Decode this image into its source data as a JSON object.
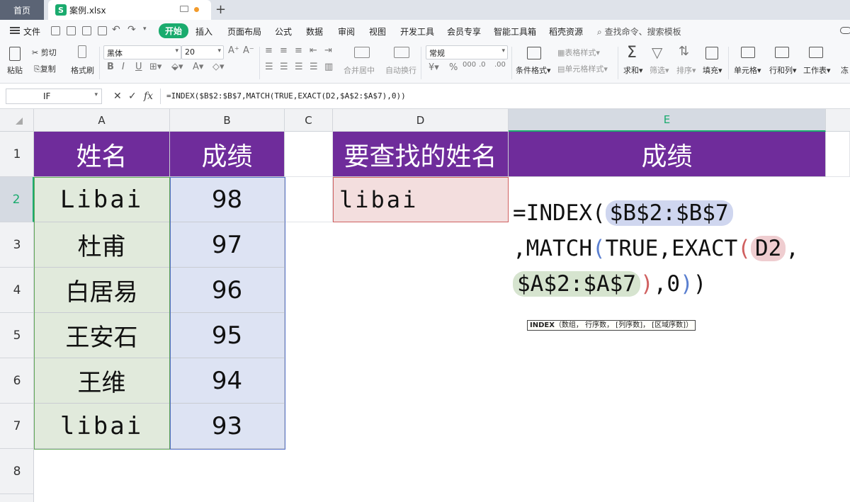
{
  "titlebar": {
    "home_tab": "首页",
    "file_tab": "案例.xlsx",
    "file_icon": "S"
  },
  "menu": {
    "file": "文件",
    "items": [
      "开始",
      "插入",
      "页面布局",
      "公式",
      "数据",
      "审阅",
      "视图",
      "开发工具",
      "会员专享",
      "智能工具箱",
      "稻壳资源"
    ],
    "active_index": 0,
    "search": "查找命令、搜索模板"
  },
  "ribbon": {
    "paste": "粘贴",
    "cut": "剪切",
    "copy": "复制",
    "format_painter": "格式刷",
    "font_name": "黑体",
    "font_size": "20",
    "number_format": "常规",
    "merge_center": "合并居中",
    "wrap_text": "自动换行",
    "conditional_format": "条件格式",
    "table_style": "表格样式",
    "cell_style": "单元格样式",
    "sum": "求和",
    "filter": "筛选",
    "sort": "排序",
    "fill": "填充",
    "cell": "单元格",
    "row_col": "行和列",
    "worksheet": "工作表",
    "freeze": "冻"
  },
  "formula_bar": {
    "name_box": "IF",
    "formula": "=INDEX($B$2:$B$7,MATCH(TRUE,EXACT(D2,$A$2:$A$7),0))"
  },
  "columns": [
    "A",
    "B",
    "C",
    "D",
    "E"
  ],
  "rows": [
    "1",
    "2",
    "3",
    "4",
    "5",
    "6",
    "7",
    "8"
  ],
  "sheet": {
    "A1": "姓名",
    "B1": "成绩",
    "D1": "要查找的姓名",
    "E1": "成绩",
    "D2": "libai",
    "names": [
      "Libai",
      "杜甫",
      "白居易",
      "王安石",
      "王维",
      "libai"
    ],
    "scores": [
      "98",
      "97",
      "96",
      "95",
      "94",
      "93"
    ]
  },
  "cell_formula": {
    "eq_index": "=INDEX(",
    "ref_b": "$B$2:$B$7",
    "match": ",MATCH",
    "open1": "(",
    "true_exact": "TRUE,EXACT",
    "open2": "(",
    "ref_d": "D2",
    "comma": ",",
    "ref_a": "$A$2:$A$7",
    "close2": ")",
    "zero": ",0",
    "close1": ")",
    "close0": ")"
  },
  "tooltip": {
    "fn": "INDEX",
    "args": "（数组， 行序数， [列序数]， [区域序数]）"
  }
}
